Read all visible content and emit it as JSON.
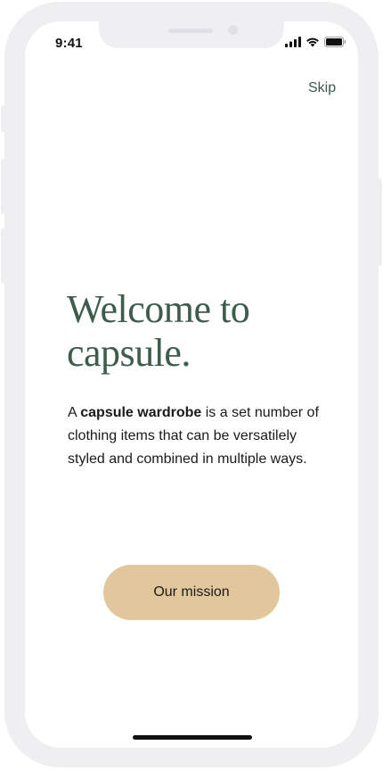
{
  "status_bar": {
    "time": "9:41",
    "icons": [
      "cellular-signal-icon",
      "wifi-icon",
      "battery-icon"
    ]
  },
  "header": {
    "skip_label": "Skip"
  },
  "onboarding": {
    "title_line1": "Welcome to",
    "title_line2": "capsule.",
    "description_prefix": "A ",
    "description_bold": "capsule wardrobe",
    "description_suffix": " is a set number of clothing items that can be versatilely styled and combined in multiple ways.",
    "mission_button_label": "Our mission"
  },
  "colors": {
    "accent_green": "#3d5c4c",
    "button_tan": "#e2c79c",
    "frame_gray": "#efeff2"
  }
}
